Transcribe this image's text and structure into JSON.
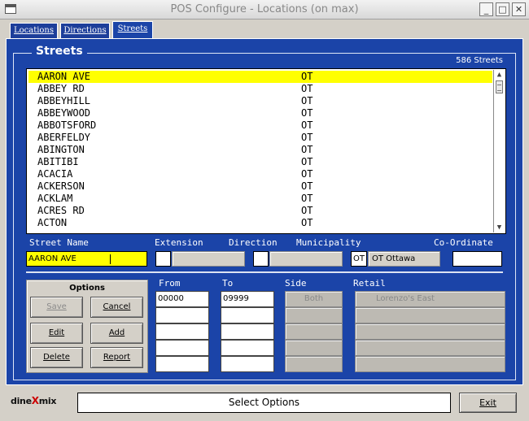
{
  "window": {
    "title": "POS Configure - Locations (on max)",
    "buttons": [
      "_",
      "□",
      "✕"
    ]
  },
  "tabs": [
    {
      "label": "Locations"
    },
    {
      "label": "Directions"
    },
    {
      "label": "Streets",
      "active": true
    }
  ],
  "streets": {
    "title": "Streets",
    "count_label": "586 Streets",
    "rows": [
      {
        "name": "AARON AVE",
        "municipality": "OT",
        "selected": true
      },
      {
        "name": "ABBEY RD",
        "municipality": "OT"
      },
      {
        "name": "ABBEYHILL",
        "municipality": "OT"
      },
      {
        "name": "ABBEYWOOD",
        "municipality": "OT"
      },
      {
        "name": "ABBOTSFORD",
        "municipality": "OT"
      },
      {
        "name": "ABERFELDY",
        "municipality": "OT"
      },
      {
        "name": "ABINGTON",
        "municipality": "OT"
      },
      {
        "name": "ABITIBI",
        "municipality": "OT"
      },
      {
        "name": "ACACIA",
        "municipality": "OT"
      },
      {
        "name": "ACKERSON",
        "municipality": "OT"
      },
      {
        "name": "ACKLAM",
        "municipality": "OT"
      },
      {
        "name": "ACRES RD",
        "municipality": "OT"
      },
      {
        "name": "ACTON",
        "municipality": "OT"
      }
    ]
  },
  "fields": {
    "street_name_label": "Street Name",
    "extension_label": "Extension",
    "direction_label": "Direction",
    "municipality_label": "Municipality",
    "coordinate_label": "Co-Ordinate",
    "street_name_value": "AARON AVE",
    "municipality_code": "OT",
    "municipality_name": "OT Ottawa"
  },
  "options": {
    "title": "Options",
    "save": "Save",
    "cancel": "Cancel",
    "edit": "Edit",
    "add": "Add",
    "delete": "Delete",
    "report": "Report"
  },
  "ranges": {
    "from_label": "From",
    "to_label": "To",
    "side_label": "Side",
    "retail_label": "Retail",
    "from_values": [
      "00000",
      "",
      "",
      "",
      ""
    ],
    "to_values": [
      "09999",
      "",
      "",
      "",
      ""
    ],
    "side_first": "Both",
    "retail_first": "Lorenzo's East"
  },
  "footer": {
    "logo_left": "dine",
    "logo_x": "X",
    "logo_right": "mix",
    "status": "Select Options",
    "exit": "Exit"
  }
}
